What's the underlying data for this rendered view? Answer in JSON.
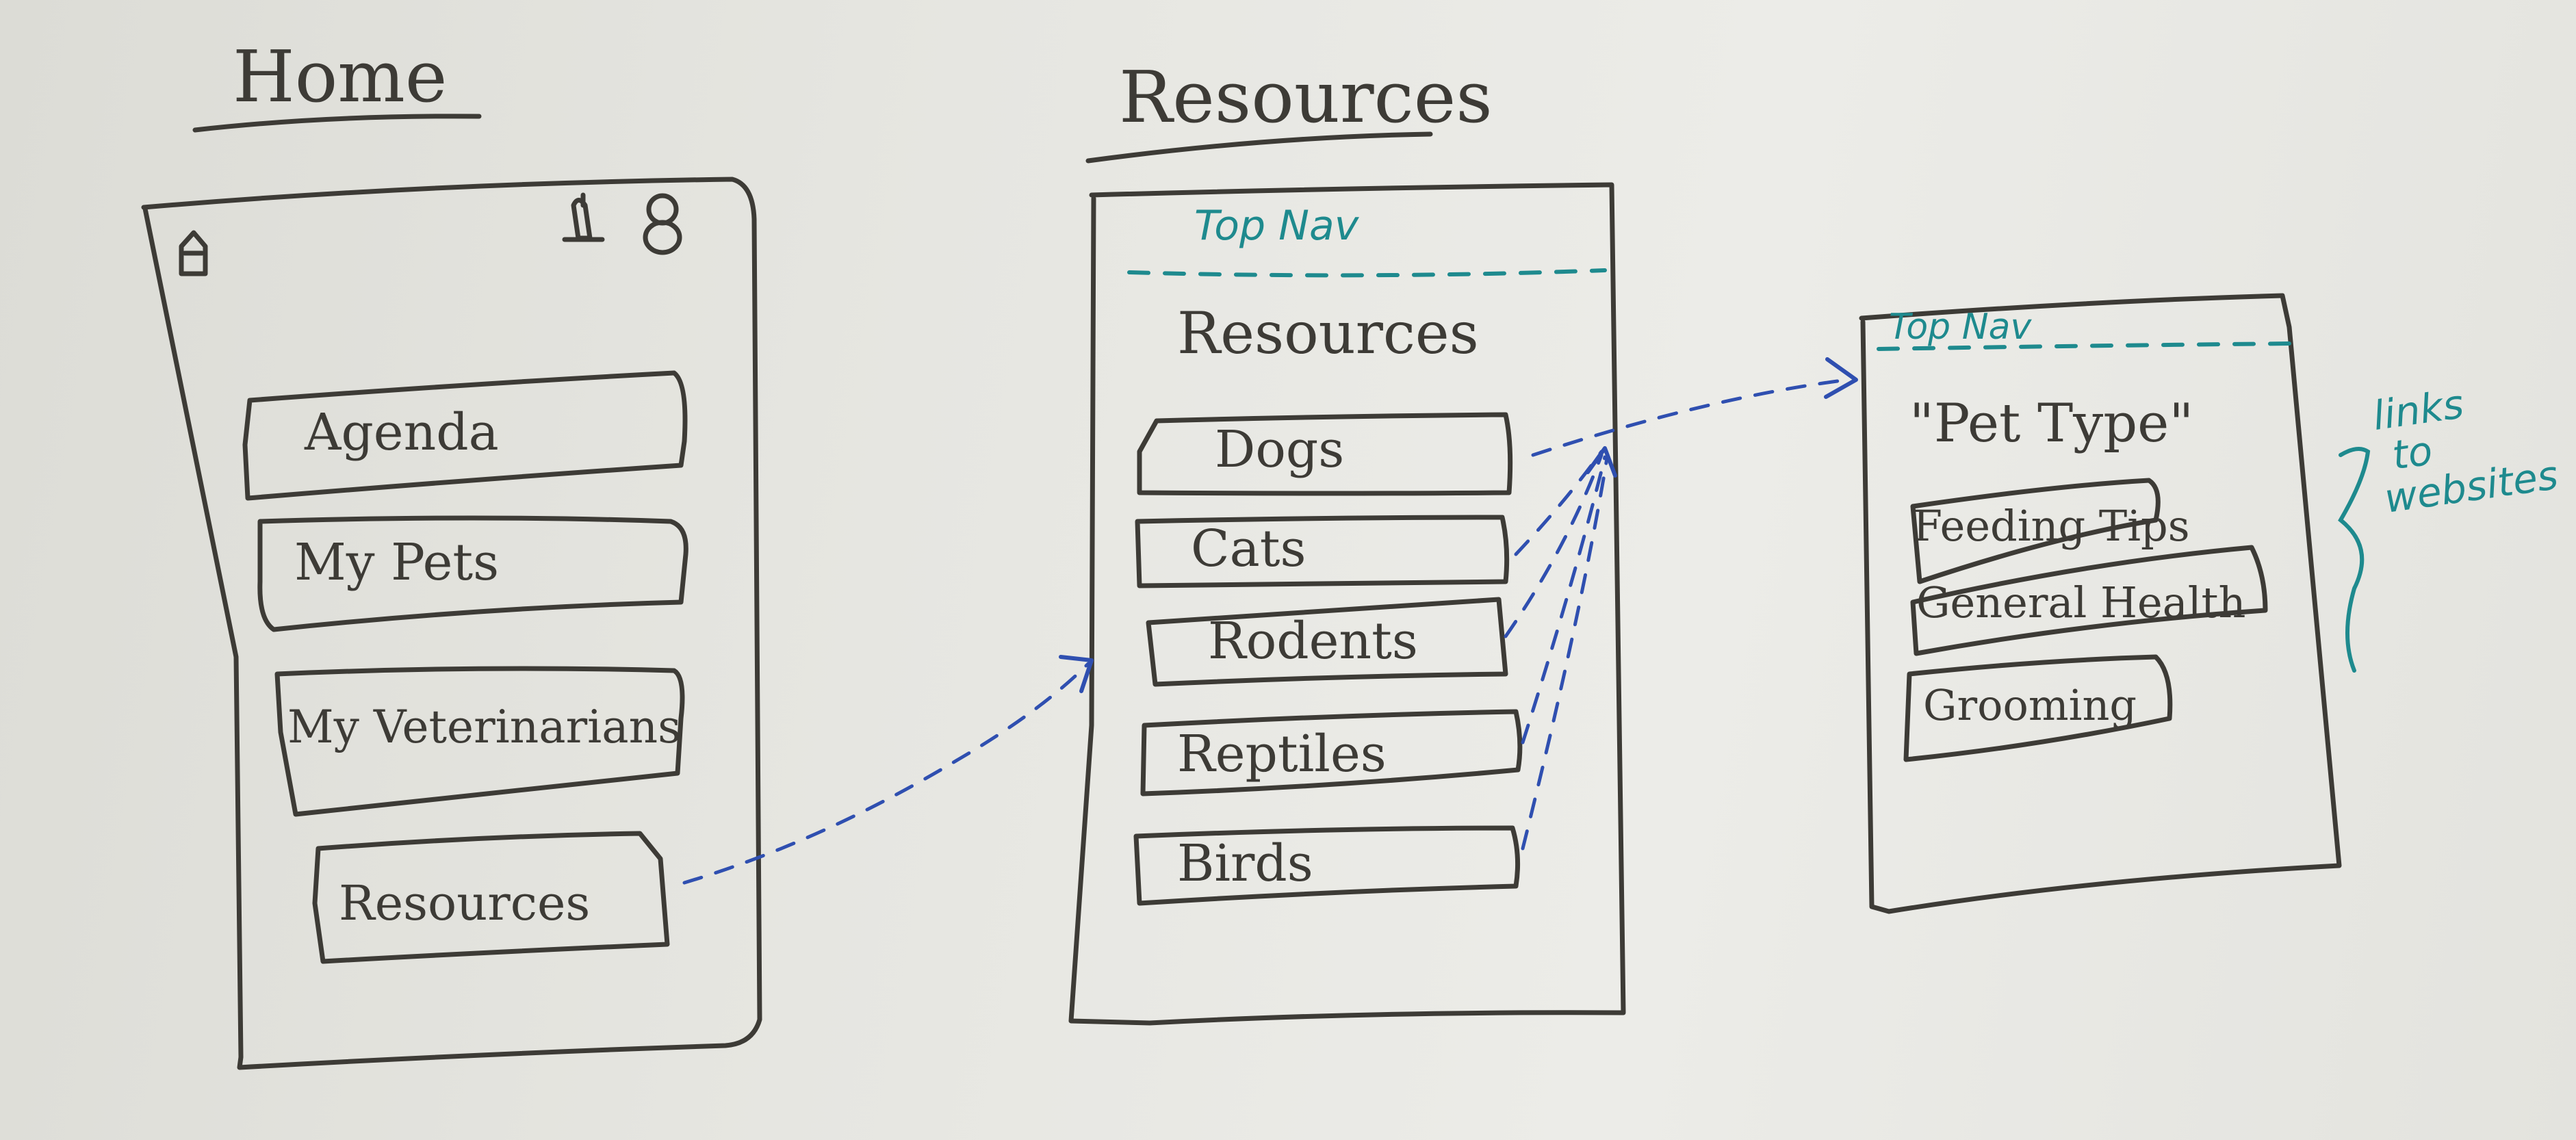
{
  "screens": {
    "home": {
      "title": "Home",
      "icons": [
        "home-icon",
        "bell-icon",
        "user-icon"
      ],
      "buttons": [
        "Agenda",
        "My Pets",
        "My Veterinarians",
        "Resources"
      ]
    },
    "resources": {
      "title": "Resources",
      "top_nav": "Top Nav",
      "heading": "Resources",
      "buttons": [
        "Dogs",
        "Cats",
        "Rodents",
        "Reptiles",
        "Birds"
      ]
    },
    "pet_type": {
      "top_nav": "Top Nav",
      "heading": "\"Pet Type\"",
      "buttons": [
        "Feeding Tips",
        "General Health",
        "Grooming"
      ]
    }
  },
  "annotation": {
    "line1": "links",
    "line2": "to",
    "line3": "websites"
  },
  "colors": {
    "board": "#e6e6e1",
    "marker": "#3d3b36",
    "teal": "#1e8a8e",
    "arrow": "#2f4fb0"
  }
}
